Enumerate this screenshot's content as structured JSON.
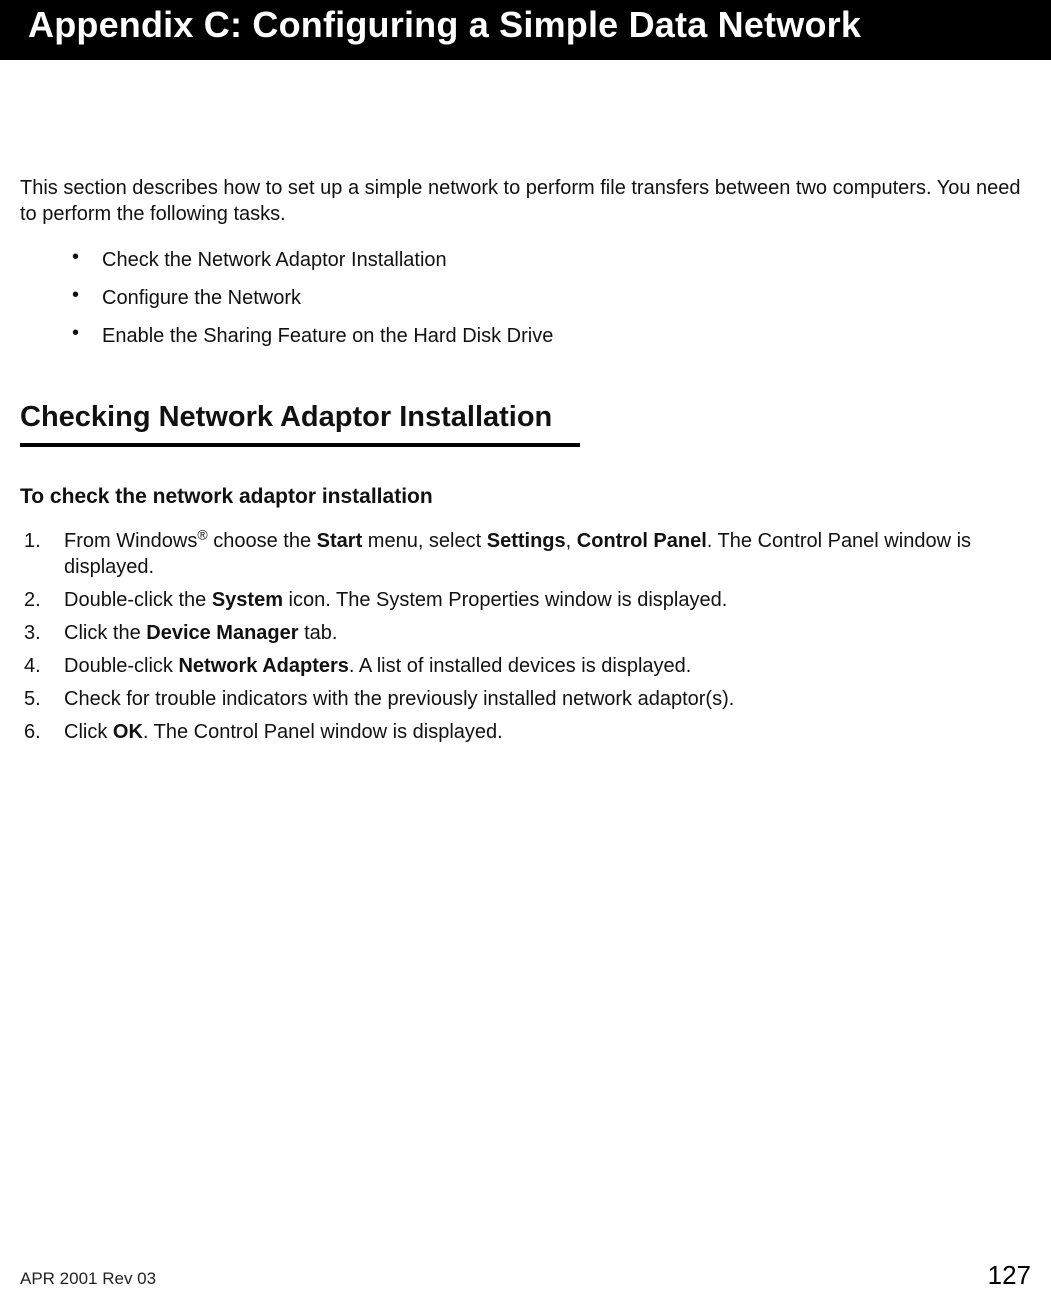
{
  "page_title": "Appendix C: Configuring a Simple Data Network",
  "intro": "This section describes how to set up a simple network to perform file transfers between two computers. You need to perform the following tasks.",
  "tasks": [
    "Check the Network Adaptor Installation",
    "Configure the Network",
    "Enable the Sharing Feature on the Hard Disk Drive"
  ],
  "section_heading": "Checking Network Adaptor Installation",
  "subheading": "To check the network adaptor installation",
  "steps": [
    {
      "pre": "From Windows",
      "sup": "®",
      "mid1": " choose the ",
      "b1": "Start",
      "mid2": " menu, select ",
      "b2": "Settings",
      "sep": ", ",
      "b3": "Control Panel",
      "post": ". The Control Panel window is displayed."
    },
    {
      "pre": "Double-click the ",
      "b1": "System",
      "post": " icon. The System Properties window is displayed."
    },
    {
      "pre": "Click the ",
      "b1": "Device Manager",
      "post": " tab."
    },
    {
      "pre": "Double-click ",
      "b1": "Network Adapters",
      "post": ". A list of installed devices is displayed."
    },
    {
      "text": "Check for trouble indicators with the previously installed network adaptor(s)."
    },
    {
      "pre": "Click ",
      "b1": "OK",
      "post": ". The Control Panel window is displayed."
    }
  ],
  "footer": {
    "left": "APR 2001 Rev 03",
    "right": "127"
  }
}
